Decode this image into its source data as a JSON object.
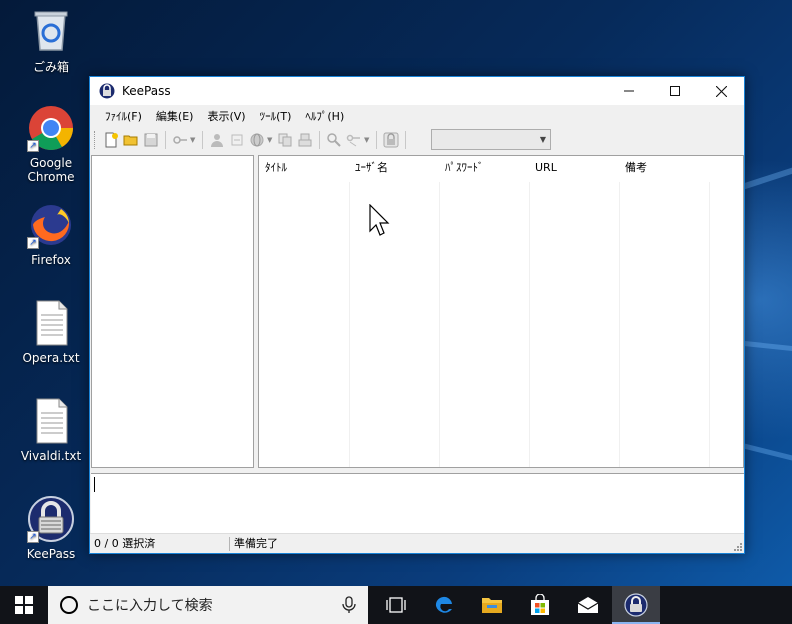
{
  "desktop": {
    "icons": [
      {
        "label": "ごみ箱"
      },
      {
        "label": "Google Chrome"
      },
      {
        "label": "Firefox"
      },
      {
        "label": "Opera.txt"
      },
      {
        "label": "Vivaldi.txt"
      },
      {
        "label": "KeePass"
      }
    ]
  },
  "window": {
    "title": "KeePass",
    "controls": {
      "minimize": "—",
      "maximize": "☐",
      "close": "✕"
    },
    "menu": [
      "ﾌｧｲﾙ(F)",
      "編集(E)",
      "表示(V)",
      "ﾂｰﾙ(T)",
      "ﾍﾙﾌﾟ(H)"
    ],
    "toolbar": {
      "search_value": ""
    },
    "columns": [
      "ﾀｲﾄﾙ",
      "ﾕｰｻﾞ名",
      "ﾊﾟｽﾜｰﾄﾞ",
      "URL",
      "備考"
    ],
    "status": {
      "left": "0 / 0 選択済",
      "right": "準備完了"
    }
  },
  "taskbar": {
    "search_placeholder": "ここに入力して検索"
  },
  "colors": {
    "accent": "#1883d7",
    "taskbar": "#111318",
    "window_bg": "#f0f0f0"
  }
}
